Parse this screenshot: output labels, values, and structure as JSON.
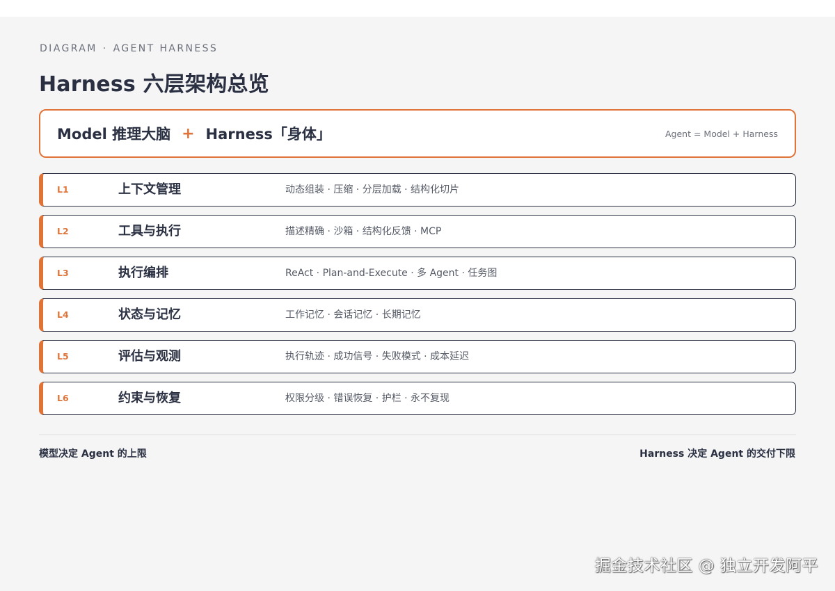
{
  "header": {
    "eyebrow_left": "DIAGRAM",
    "eyebrow_separator": "·",
    "eyebrow_right": "AGENT HARNESS",
    "title": "Harness 六层架构总览"
  },
  "hero": {
    "left_text": "Model 推理大脑",
    "plus": "+",
    "right_text": "Harness「身体」",
    "formula": "Agent = Model + Harness"
  },
  "layers": [
    {
      "code": "L1",
      "name": "上下文管理",
      "desc": "动态组装 · 压缩 · 分层加载 · 结构化切片"
    },
    {
      "code": "L2",
      "name": "工具与执行",
      "desc": "描述精确 · 沙箱 · 结构化反馈 · MCP"
    },
    {
      "code": "L3",
      "name": "执行编排",
      "desc": "ReAct · Plan-and-Execute · 多 Agent · 任务图"
    },
    {
      "code": "L4",
      "name": "状态与记忆",
      "desc": "工作记忆 · 会话记忆 · 长期记忆"
    },
    {
      "code": "L5",
      "name": "评估与观测",
      "desc": "执行轨迹 · 成功信号 · 失败模式 · 成本延迟"
    },
    {
      "code": "L6",
      "name": "约束与恢复",
      "desc": "权限分级 · 错误恢复 · 护栏 · 永不复现"
    }
  ],
  "footer": {
    "left": "模型决定 Agent 的上限",
    "right": "Harness 决定 Agent 的交付下限"
  },
  "watermark": "掘金技术社区 @ 独立开发阿平",
  "colors": {
    "accent": "#e07438",
    "text_dark": "#2a3042",
    "background": "#f5f5f5"
  }
}
